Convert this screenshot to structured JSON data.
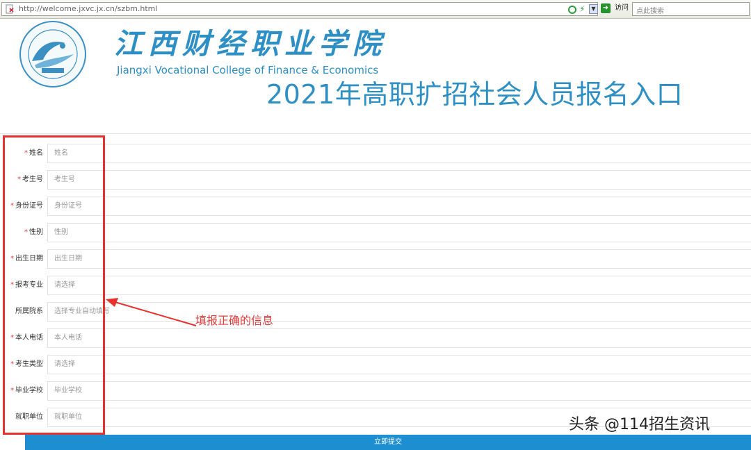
{
  "browser": {
    "url": "http://welcome.jxvc.jx.cn/szbm.html",
    "go_label": "访问",
    "search_placeholder": "点此搜索"
  },
  "header": {
    "school_cn": "江西财经职业学院",
    "school_en": "Jiangxi Vocational College of Finance & Economics",
    "title": "2021年高职扩招社会人员报名入口"
  },
  "form": {
    "fields": [
      {
        "label": "姓名",
        "required": true,
        "placeholder": "姓名"
      },
      {
        "label": "考生号",
        "required": true,
        "placeholder": "考生号"
      },
      {
        "label": "身份证号",
        "required": true,
        "placeholder": "身份证号"
      },
      {
        "label": "性别",
        "required": true,
        "placeholder": "性别"
      },
      {
        "label": "出生日期",
        "required": true,
        "placeholder": "出生日期"
      },
      {
        "label": "报考专业",
        "required": true,
        "placeholder": "请选择"
      },
      {
        "label": "所属院系",
        "required": false,
        "placeholder": "选择专业自动填写"
      },
      {
        "label": "本人电话",
        "required": true,
        "placeholder": "本人电话"
      },
      {
        "label": "考生类型",
        "required": true,
        "placeholder": "请选择"
      },
      {
        "label": "毕业学校",
        "required": true,
        "placeholder": "毕业学校"
      },
      {
        "label": "就职单位",
        "required": false,
        "placeholder": "就职单位"
      }
    ],
    "required_mark": "*",
    "submit_label": "立即提交"
  },
  "annotation": {
    "text": "填报正确的信息"
  },
  "watermark": {
    "text": "头条 @114招生资讯"
  },
  "colors": {
    "brand": "#2d8fc4",
    "submit": "#1d8fd1",
    "annotation": "#e8312d"
  }
}
